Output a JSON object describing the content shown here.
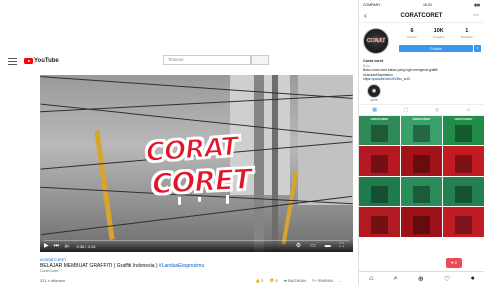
{
  "youtube": {
    "logo_text": "YouTube",
    "search_placeholder": "Telusuri",
    "player": {
      "graffiti_line1": "CORAT",
      "graffiti_line2": "CORET",
      "time": "0:38 / 4:15"
    },
    "video": {
      "tag": "#CORATCORET",
      "title": "BELAJAR MEMBUAT GRAFFITI ( Graffiti Indonesia )",
      "hashtag": "#LandasEkspresimu",
      "channel": "Corat Coret",
      "views": "321 x ditonton",
      "like_count": "2",
      "dislike_count": "0",
      "share_label": "BAGIKAN",
      "save_label": "SIMPAN",
      "more_label": "..."
    }
  },
  "instagram": {
    "status_bar": {
      "carrier": "COMPANY",
      "time": "16:30",
      "battery": "▮▮▮"
    },
    "username": "CORATCORET",
    "stats": [
      {
        "number": "6",
        "label": "Kiriman"
      },
      {
        "number": "10K",
        "label": "Pengikut"
      },
      {
        "number": "1",
        "label": "Mengikuti"
      }
    ],
    "follow_label": "Follow",
    "bio": {
      "name": "Corat coret",
      "category": "Buku",
      "line1": "Buku corat coret kalian yang ingin mengenal graffiti",
      "line2": "#LandasEkspresimu",
      "link": "https://youtube.be/U4V3ez_sr10"
    },
    "highlight_label": "GOTS",
    "heart_count": "6",
    "grid": [
      {
        "caption": "CORATCORET",
        "bg": "#2e8b57"
      },
      {
        "caption": "CORATCORET",
        "bg": "#3aa06a"
      },
      {
        "caption": "CORATCORET",
        "bg": "#228b4a"
      },
      {
        "caption": "",
        "bg": "#b41822"
      },
      {
        "caption": "",
        "bg": "#a11318"
      },
      {
        "caption": "",
        "bg": "#c21b24"
      },
      {
        "caption": "",
        "bg": "#1f7a4c"
      },
      {
        "caption": "",
        "bg": "#2a8c58"
      },
      {
        "caption": "",
        "bg": "#257f50"
      },
      {
        "caption": "",
        "bg": "#b01a20"
      },
      {
        "caption": "",
        "bg": "#9c1218"
      },
      {
        "caption": "",
        "bg": "#c01c25"
      }
    ]
  }
}
